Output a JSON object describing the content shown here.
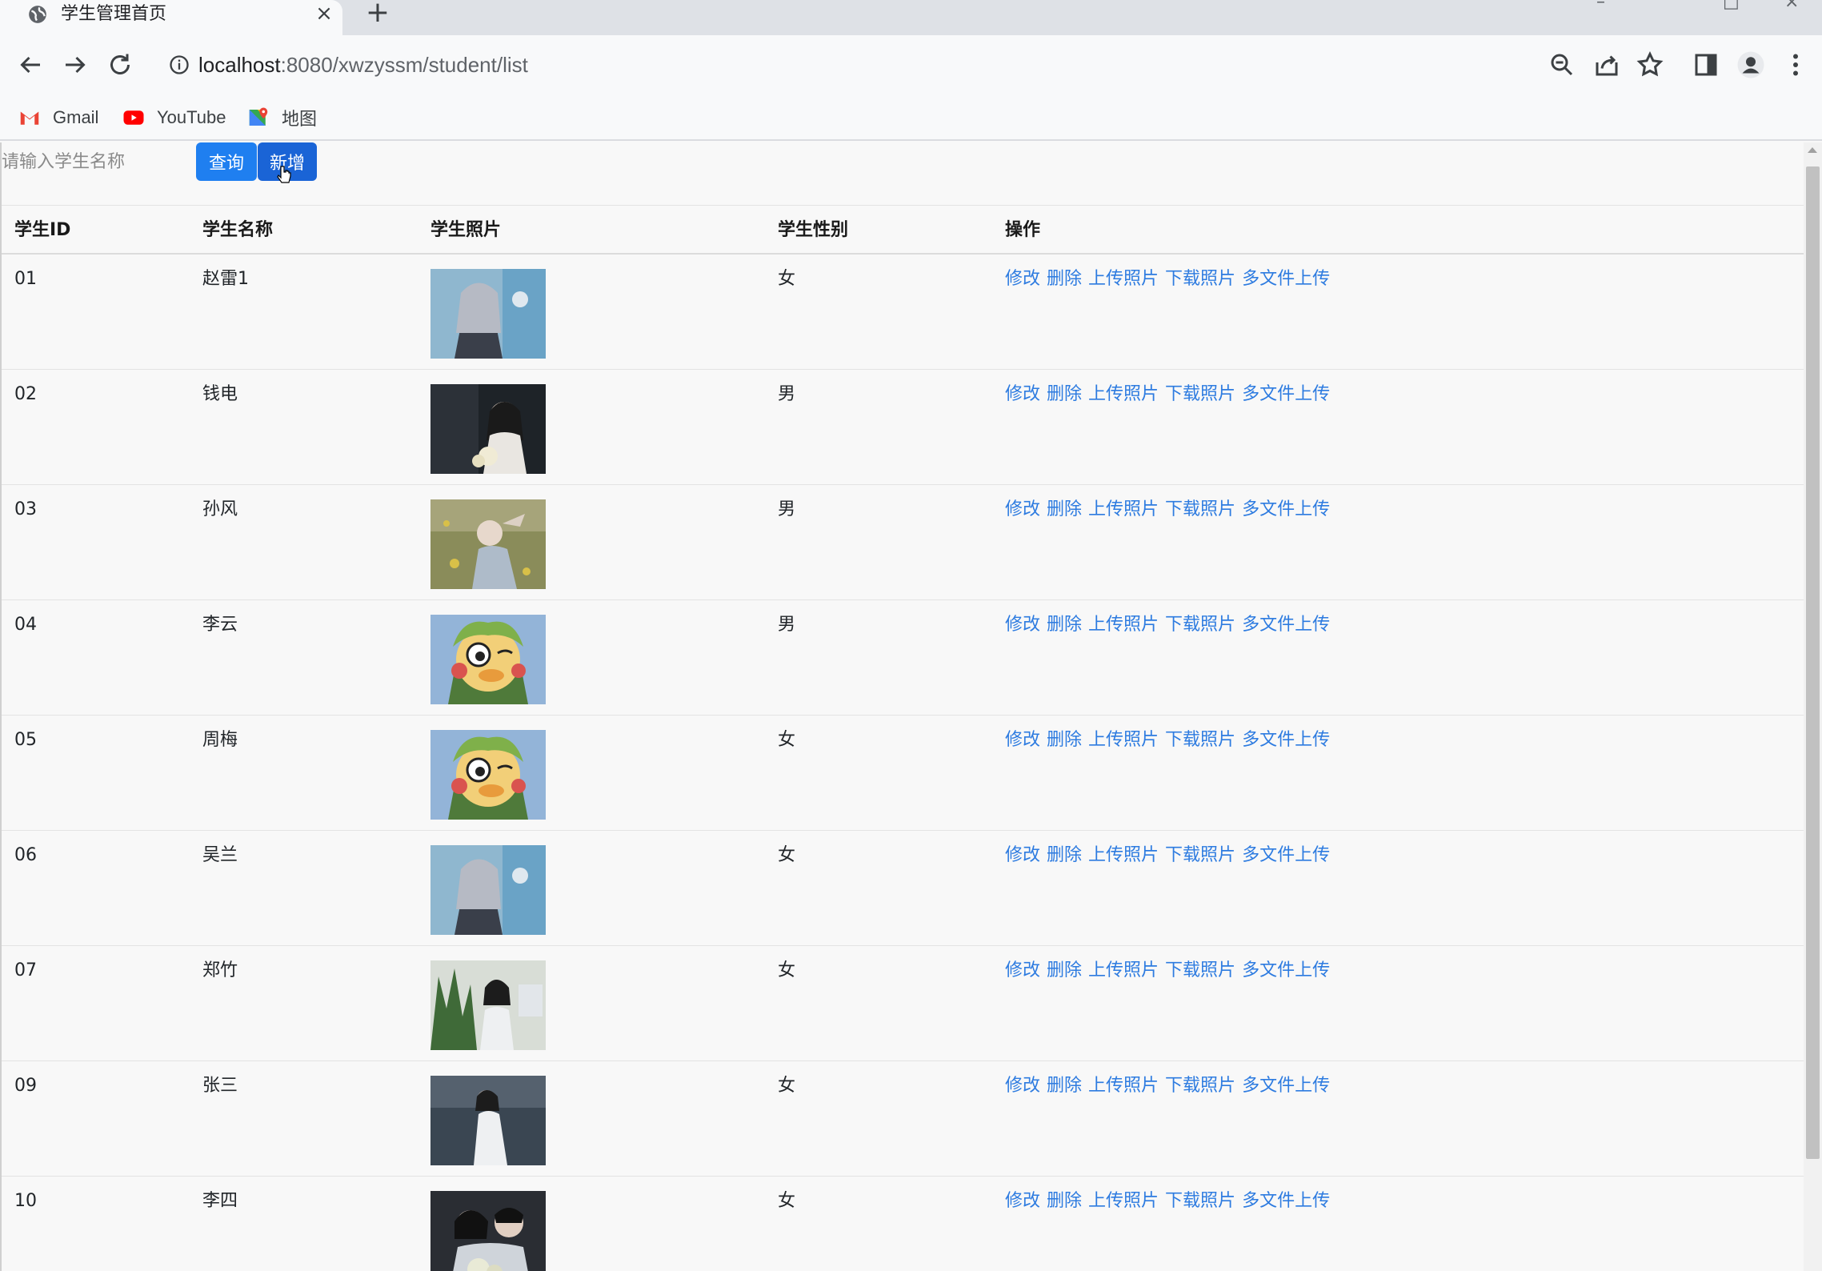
{
  "browser": {
    "tab_title": "学生管理首页",
    "url_host": "localhost",
    "url_path": ":8080/xwzyssm/student/list",
    "bookmarks": [
      {
        "label": "Gmail",
        "icon": "gmail-icon"
      },
      {
        "label": "YouTube",
        "icon": "youtube-icon"
      },
      {
        "label": "地图",
        "icon": "maps-icon"
      }
    ]
  },
  "search": {
    "placeholder": "请输入学生名称",
    "query_label": "查询",
    "add_label": "新增"
  },
  "table": {
    "headers": [
      "学生ID",
      "学生名称",
      "学生照片",
      "学生性别",
      "操作"
    ],
    "operations": [
      "修改",
      "删除",
      "上传照片",
      "下载照片",
      "多文件上传"
    ],
    "rows": [
      {
        "id": "01",
        "name": "赵雷1",
        "sex": "女",
        "photo": "anime-girl-photo"
      },
      {
        "id": "02",
        "name": "钱电",
        "sex": "男",
        "photo": "girl-flowers-photo"
      },
      {
        "id": "03",
        "name": "孙风",
        "sex": "男",
        "photo": "girl-field-photo"
      },
      {
        "id": "04",
        "name": "李云",
        "sex": "男",
        "photo": "cartoon-duck-photo"
      },
      {
        "id": "05",
        "name": "周梅",
        "sex": "女",
        "photo": "cartoon-duck-photo"
      },
      {
        "id": "06",
        "name": "吴兰",
        "sex": "女",
        "photo": "anime-girl-photo"
      },
      {
        "id": "07",
        "name": "郑竹",
        "sex": "女",
        "photo": "girl-plants-photo"
      },
      {
        "id": "09",
        "name": "张三",
        "sex": "女",
        "photo": "girl-white-dress-photo"
      },
      {
        "id": "10",
        "name": "李四",
        "sex": "女",
        "photo": "couple-photo"
      }
    ]
  },
  "colors": {
    "link": "#2d7be0",
    "button": "#1f7ff0",
    "button_active": "#1a64d6"
  }
}
